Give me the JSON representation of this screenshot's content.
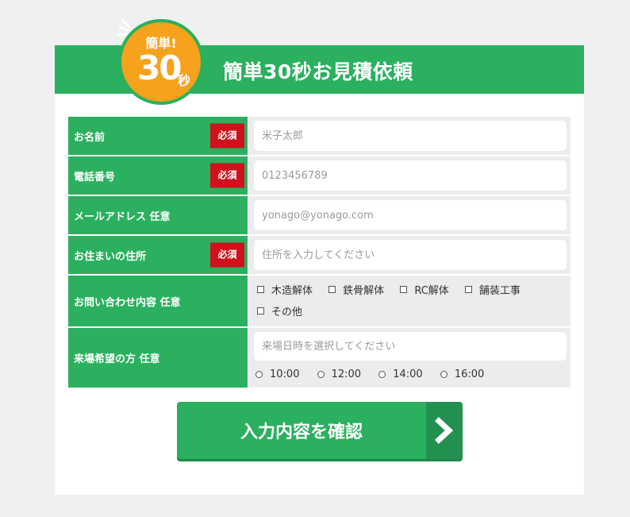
{
  "header": {
    "title": "簡単30秒お見積依頼",
    "badge": {
      "top": "簡単!",
      "number": "30",
      "unit": "秒"
    }
  },
  "required_label": "必須",
  "rows": [
    {
      "label": "お名前",
      "required": true,
      "placeholder": "米子太郎"
    },
    {
      "label": "電話番号",
      "required": true,
      "placeholder": "0123456789"
    },
    {
      "label": "メールアドレス 任意",
      "required": false,
      "placeholder": "yonago@yonago.com"
    },
    {
      "label": "お住まいの住所",
      "required": true,
      "placeholder": "住所を入力してください"
    },
    {
      "label": "お問い合わせ内容 任意",
      "required": false,
      "options": [
        "木造解体",
        "鉄骨解体",
        "RC解体",
        "舗装工事",
        "その他"
      ]
    },
    {
      "label": "来場希望の方 任意",
      "required": false,
      "placeholder": "来場日時を選択してください",
      "times": [
        "10:00",
        "12:00",
        "14:00",
        "16:00"
      ]
    }
  ],
  "submit": {
    "label": "入力内容を確認"
  },
  "colors": {
    "green": "#2ab05e",
    "red": "#d0111b",
    "orange": "#f6a21c"
  }
}
